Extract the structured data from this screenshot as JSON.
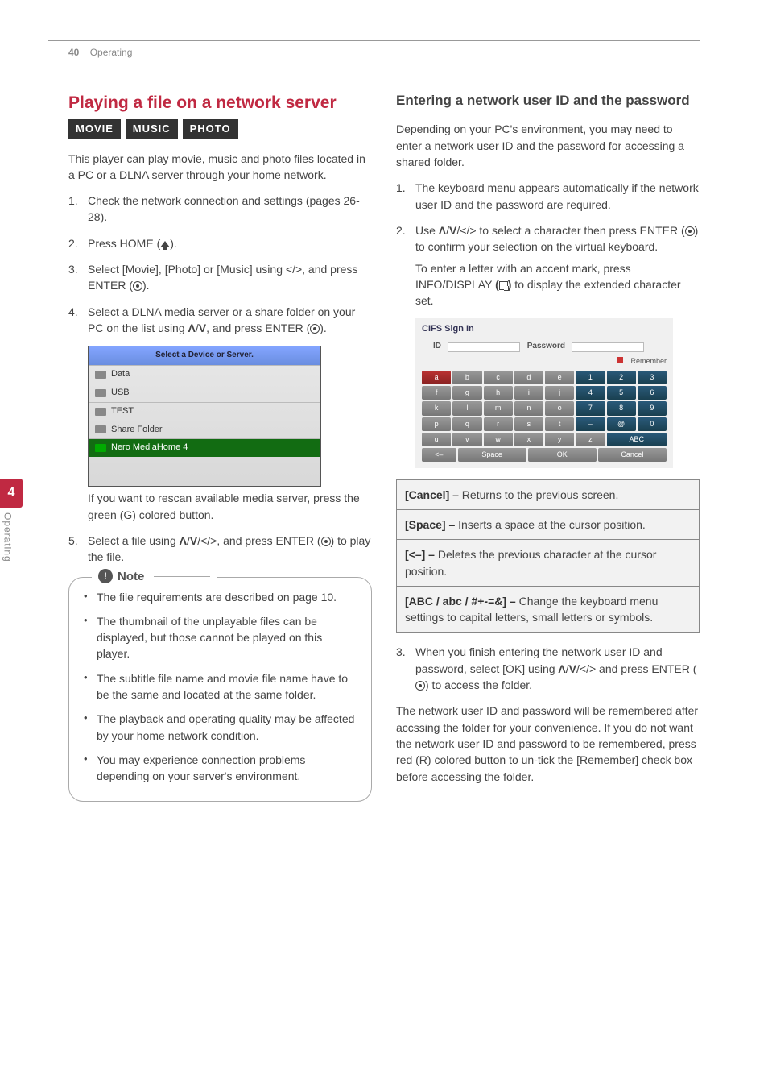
{
  "header": {
    "page_num": "40",
    "section": "Operating"
  },
  "side": {
    "num": "4",
    "label": "Operating"
  },
  "left": {
    "title": "Playing a file on a network server",
    "badges": [
      "MOVIE",
      "MUSIC",
      "PHOTO"
    ],
    "intro": "This player can play movie, music and photo files located in a PC or a DLNA server through your home network.",
    "steps": [
      "Check the network connection and settings (pages 26-28).",
      "Press HOME (🏠).",
      "Select [Movie], [Photo] or [Music] using </>, and press ENTER (◉).",
      "Select a DLNA media server or a share folder on your PC on the list using Λ/V, and press ENTER (◉)."
    ],
    "shot1": {
      "bar": "Select a Device or Server.",
      "rows": [
        "Data",
        "USB",
        "TEST",
        "Share Folder",
        "Nero MediaHome 4"
      ]
    },
    "rescan": "If you want to rescan available media server, press the green (G) colored button.",
    "step5": "Select a file using Λ/V/</>, and press ENTER (◉) to play the file.",
    "note_label": "Note",
    "notes": [
      "The file requirements are described on page 10.",
      "The thumbnail of the unplayable files can be displayed, but those cannot be played on this player.",
      "The subtitle file name and movie file name have to be the same and located at the same folder.",
      "The playback and operating quality may be affected by your home network condition.",
      "You may experience connection problems depending on your server's environment."
    ]
  },
  "right": {
    "heading": "Entering a network user ID and the password",
    "p1": "Depending on your PC's environment, you may need to enter a network user ID and the password for accessing a shared folder.",
    "steps12": [
      "The keyboard menu appears automatically if the network user ID and the password are required.",
      "Use Λ/V/</> to select a character then press ENTER (◉) to confirm your selection on the virtual keyboard."
    ],
    "accent": "To enter a letter with an accent mark, press INFO/DISPLAY (▢) to display the extended character set.",
    "shot2": {
      "title": "CIFS Sign In",
      "id": "ID",
      "pwd": "Password",
      "remember": "Remember",
      "keys_row1": [
        "a",
        "b",
        "c",
        "d",
        "e",
        "1",
        "2",
        "3"
      ],
      "keys_row2": [
        "f",
        "g",
        "h",
        "i",
        "j",
        "4",
        "5",
        "6"
      ],
      "keys_row3": [
        "k",
        "l",
        "m",
        "n",
        "o",
        "7",
        "8",
        "9"
      ],
      "keys_row4": [
        "p",
        "q",
        "r",
        "s",
        "t",
        "–",
        "@",
        "0"
      ],
      "keys_row5": [
        "u",
        "v",
        "w",
        "x",
        "y",
        "z",
        "ABC"
      ],
      "bottom": [
        "<–",
        "Space",
        "OK",
        "Cancel"
      ]
    },
    "defs": [
      {
        "b": "[Cancel] –",
        "t": " Returns to the previous screen."
      },
      {
        "b": "[Space] –",
        "t": " Inserts a space at the cursor position."
      },
      {
        "b": "[<–] –",
        "t": " Deletes the previous character at the cursor position."
      },
      {
        "b": "[ABC / abc / #+-=&] –",
        "t": " Change the keyboard menu settings to capital letters, small letters or symbols."
      }
    ],
    "step3": "When you finish entering the network user ID and password, select [OK] using Λ/V/</> and press ENTER (◉) to access the folder.",
    "closing": "The network user ID and password will be remembered after accssing the folder for your convenience. If you do not want the network user ID and password to be remembered, press red (R) colored button to un-tick the [Remember] check box before accessing the folder."
  }
}
